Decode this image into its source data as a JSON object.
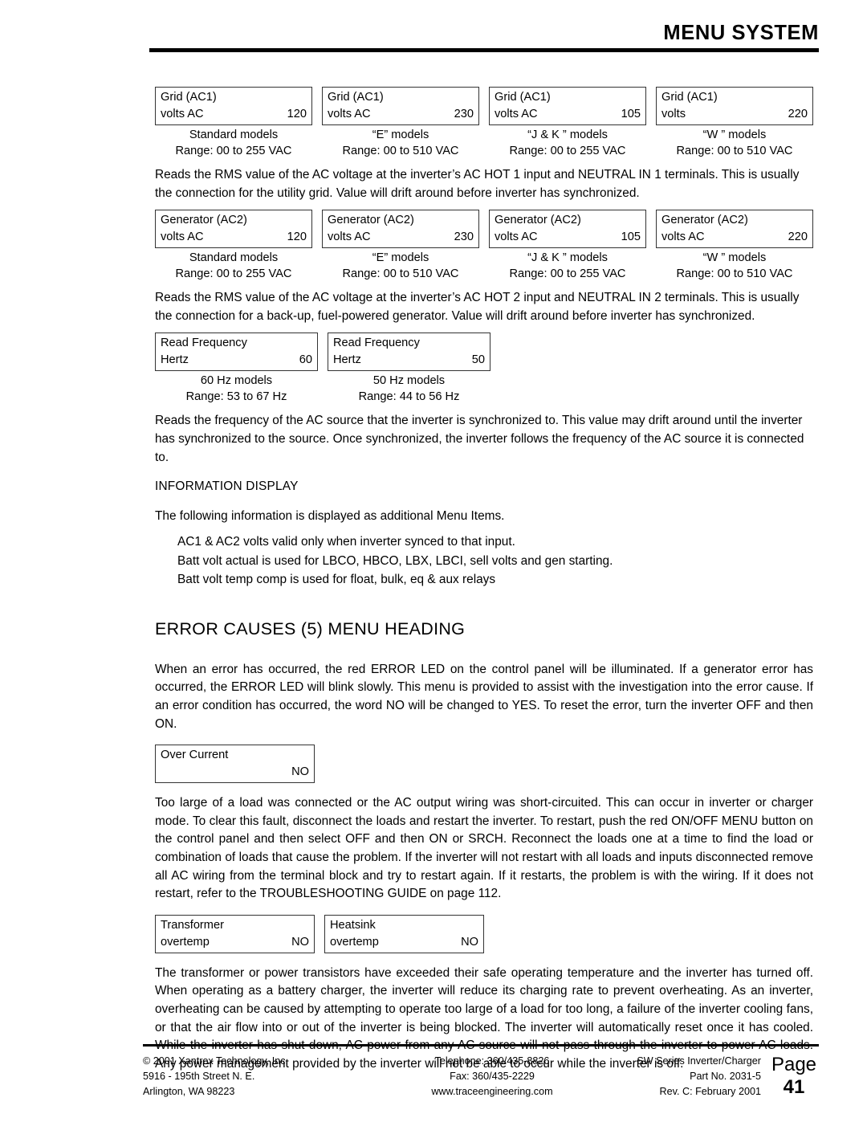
{
  "header": {
    "title": "MENU SYSTEM"
  },
  "grid_ac1": {
    "boxes": [
      {
        "line1": "Grid (AC1)",
        "label": "volts AC",
        "value": "120",
        "caption1": "Standard models",
        "caption2": "Range: 00 to 255 VAC"
      },
      {
        "line1": "Grid (AC1)",
        "label": "volts AC",
        "value": "230",
        "caption1": "“E” models",
        "caption2": "Range: 00 to 510 VAC"
      },
      {
        "line1": "Grid (AC1)",
        "label": "volts AC",
        "value": "105",
        "caption1": "“J & K ” models",
        "caption2": "Range: 00 to 255 VAC"
      },
      {
        "line1": "Grid (AC1)",
        "label": "volts",
        "value": "220",
        "caption1": "“W ” models",
        "caption2": "Range: 00 to 510 VAC"
      }
    ],
    "paragraph": "Reads the RMS value of the AC voltage at the inverter’s AC HOT 1 input and NEUTRAL IN 1 terminals. This is usually the connection for the utility grid. Value will drift around before inverter has synchronized."
  },
  "generator_ac2": {
    "boxes": [
      {
        "line1": "Generator (AC2)",
        "label": "volts AC",
        "value": "120",
        "caption1": "Standard models",
        "caption2": "Range: 00 to 255 VAC"
      },
      {
        "line1": "Generator (AC2)",
        "label": "volts AC",
        "value": "230",
        "caption1": "“E” models",
        "caption2": "Range: 00 to 510 VAC"
      },
      {
        "line1": "Generator (AC2)",
        "label": "volts AC",
        "value": "105",
        "caption1": "“J & K ” models",
        "caption2": "Range: 00 to 255 VAC"
      },
      {
        "line1": "Generator (AC2)",
        "label": "volts AC",
        "value": "220",
        "caption1": "“W ” models",
        "caption2": "Range: 00 to 510 VAC"
      }
    ],
    "paragraph": "Reads the RMS value of the AC voltage at the inverter’s AC HOT 2 input and NEUTRAL IN 2 terminals. This is usually the connection for a back-up, fuel-powered generator. Value will drift around before inverter has synchronized."
  },
  "read_frequency": {
    "boxes": [
      {
        "line1": "Read Frequency",
        "label": "Hertz",
        "value": "60",
        "caption1": "60 Hz models",
        "caption2": "Range: 53 to 67 Hz"
      },
      {
        "line1": "Read Frequency",
        "label": "Hertz",
        "value": "50",
        "caption1": "50 Hz models",
        "caption2": "Range: 44 to 56 Hz"
      }
    ],
    "paragraph": "Reads the frequency of the AC source that the inverter is synchronized to. This value may drift around until the inverter has synchronized to the source. Once synchronized, the inverter follows the frequency of the AC source it is connected to."
  },
  "information_display": {
    "heading": "INFORMATION DISPLAY",
    "intro": "The following information is displayed as additional Menu Items.",
    "items": [
      "AC1 & AC2 volts valid only when inverter synced to that input.",
      "Batt volt actual is used for LBCO, HBCO, LBX, LBCI, sell volts and gen starting.",
      "Batt volt temp comp is used for float, bulk, eq & aux relays"
    ]
  },
  "error_causes": {
    "heading": "ERROR CAUSES (5) MENU HEADING",
    "intro": "When an error has occurred, the red ERROR LED on the control panel will be illuminated. If a generator error has occurred, the ERROR LED will blink slowly. This menu is provided to assist with the investigation into the error cause. If an error condition has occurred, the word NO will be changed to YES. To reset the error, turn the inverter OFF and then ON.",
    "over_current": {
      "line1": "Over Current",
      "value": "NO"
    },
    "over_current_paragraph": "Too large of a load was connected or the AC output wiring was short-circuited. This can occur in inverter or charger mode. To clear this fault, disconnect the loads and restart the inverter. To restart, push the red ON/OFF MENU button on the control panel and then select OFF and then ON or SRCH. Reconnect the loads one at a time to find the load or combination of loads that cause the problem. If the inverter will not restart with all loads and inputs disconnected remove all AC wiring from the terminal block and try to restart again. If it restarts, the problem is with the wiring. If it does not restart, refer to the TROUBLESHOOTING GUIDE on page 112.",
    "overtemp_boxes": [
      {
        "line1": "Transformer",
        "label": "overtemp",
        "value": "NO"
      },
      {
        "line1": "Heatsink",
        "label": "overtemp",
        "value": "NO"
      }
    ],
    "overtemp_paragraph": "The transformer or power transistors have exceeded their safe operating temperature and the inverter has turned off. When operating as a battery charger, the inverter will reduce its charging rate to prevent overheating. As an inverter, overheating can be caused by attempting to operate too large of a load for too long, a failure of the inverter cooling fans, or that the air flow into or out of the inverter is being blocked. The inverter will automatically reset once it has cooled. While the inverter has shut down, AC power from any AC source will not pass through the inverter to power AC loads. Any power management provided by the inverter will not be able to occur while the inverter is off."
  },
  "footer": {
    "left": [
      "© 2001  Xantrex Technology, Inc.",
      "5916 - 195th Street N. E.",
      "Arlington, WA 98223"
    ],
    "middle": [
      "Telephone: 360/435-8826",
      "Fax: 360/435-2229",
      "www.traceengineering.com"
    ],
    "right": [
      "SW Series Inverter/Charger",
      "Part No. 2031-5",
      "Rev. C:  February 2001"
    ],
    "page_word": "Page",
    "page_number": "41"
  }
}
